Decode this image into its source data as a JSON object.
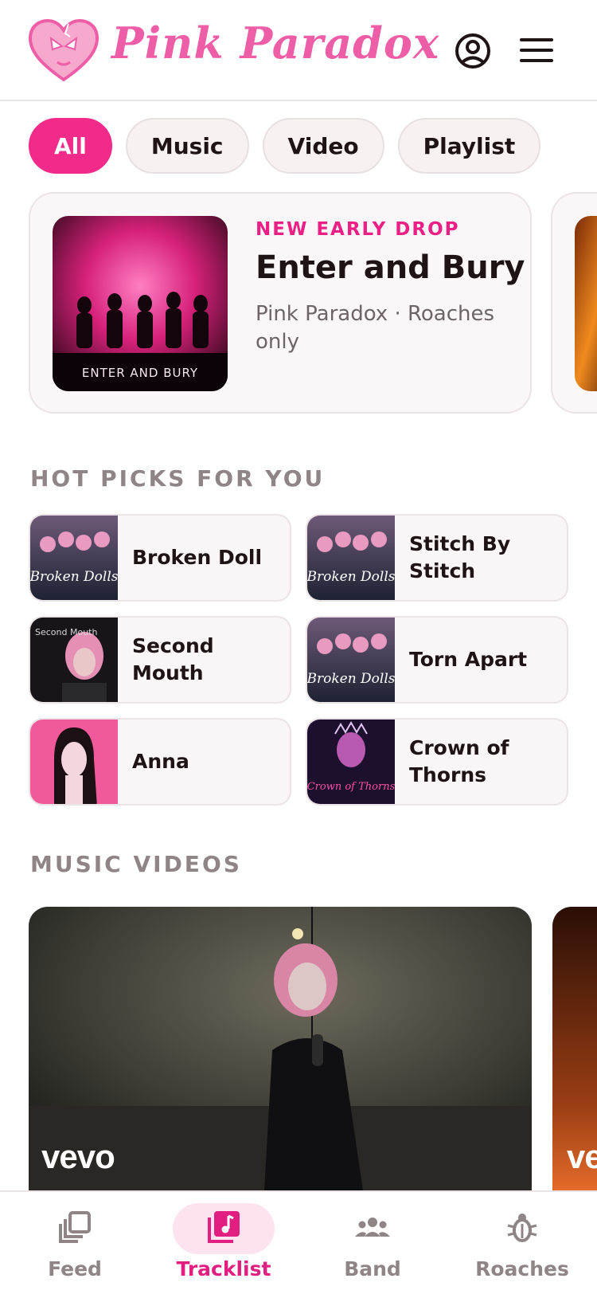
{
  "header": {
    "brand": "Pink Paradox",
    "account_icon": "account-circle-icon",
    "menu_icon": "hamburger-menu-icon"
  },
  "filters": [
    {
      "label": "All",
      "active": true
    },
    {
      "label": "Music",
      "active": false
    },
    {
      "label": "Video",
      "active": false
    },
    {
      "label": "Playlist",
      "active": false
    }
  ],
  "featured": {
    "eyebrow": "NEW EARLY DROP",
    "title": "Enter and Bury",
    "subtitle": "Pink Paradox · Roaches only",
    "art_caption": "ENTER AND BURY"
  },
  "hot_picks": {
    "heading": "HOT PICKS FOR YOU",
    "items": [
      {
        "title": "Broken Doll",
        "art": "Broken Dolls"
      },
      {
        "title": "Stitch By Stitch",
        "art": "Broken Dolls"
      },
      {
        "title": "Second Mouth",
        "art": "Second Mouth"
      },
      {
        "title": "Torn Apart",
        "art": "Broken Dolls"
      },
      {
        "title": "Anna",
        "art": ""
      },
      {
        "title": "Crown of Thorns",
        "art": "Crown of Thorns"
      }
    ]
  },
  "music_videos": {
    "heading": "MUSIC VIDEOS",
    "watermark": "vevo"
  },
  "bottom_nav": [
    {
      "label": "Feed",
      "icon": "feed-stack-icon",
      "active": false
    },
    {
      "label": "Tracklist",
      "icon": "music-note-icon",
      "active": true
    },
    {
      "label": "Band",
      "icon": "group-icon",
      "active": false
    },
    {
      "label": "Roaches",
      "icon": "bug-icon",
      "active": false
    }
  ],
  "colors": {
    "accent": "#f22a8a",
    "accent_text": "#ec1f84",
    "logo_pink": "#ee5ea7",
    "muted": "#8f8587"
  }
}
